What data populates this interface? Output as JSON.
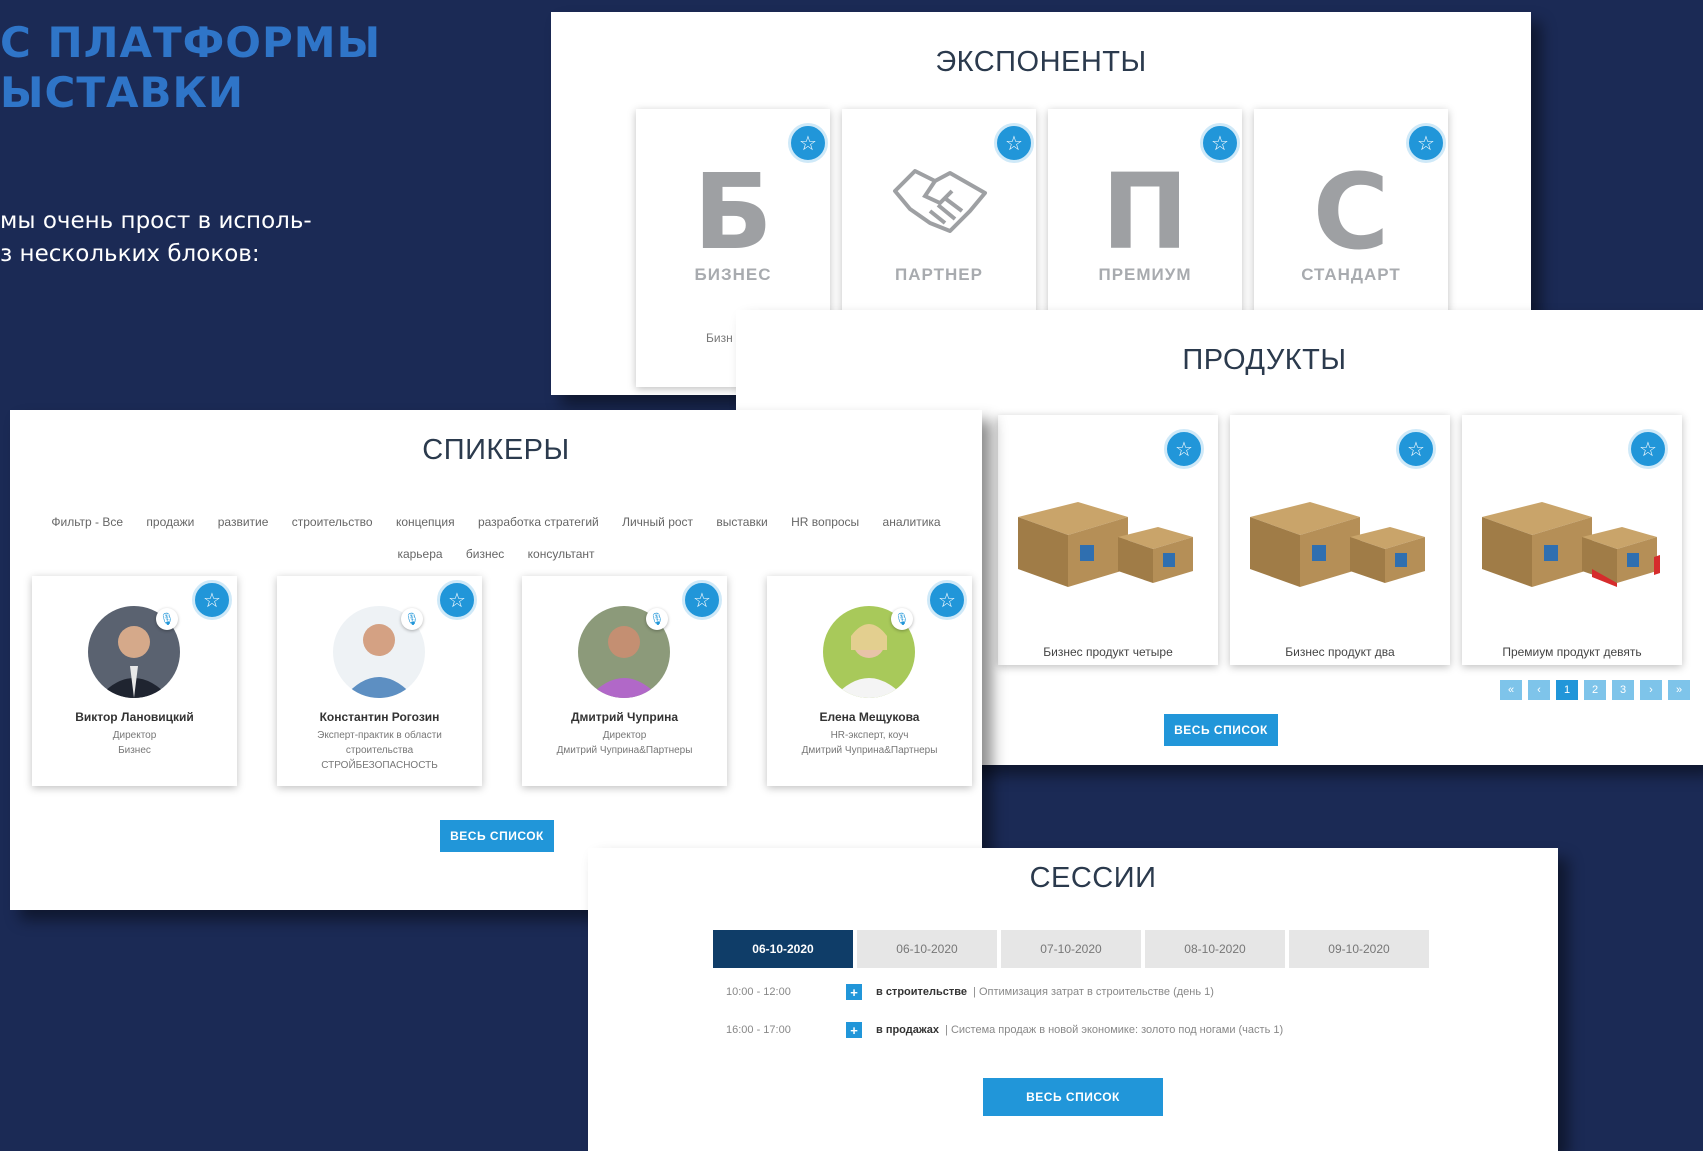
{
  "heading": {
    "line1": "С ПЛАТФОРМЫ",
    "line2": "ЫСТАВКИ"
  },
  "intro": {
    "line1": "мы очень прост в исполь-",
    "line2": "з нескольких блоков:"
  },
  "exhibitors": {
    "title": "ЭКСПОНЕНТЫ",
    "cards": [
      {
        "letter": "Б",
        "label": "БИЗНЕС",
        "sub": "Бизн"
      },
      {
        "letter": "",
        "label": "ПАРТНЕР",
        "sub": ""
      },
      {
        "letter": "П",
        "label": "ПРЕМИУМ",
        "sub": ""
      },
      {
        "letter": "С",
        "label": "СТАНДАРТ",
        "sub": ""
      }
    ]
  },
  "products": {
    "title": "ПРОДУКТЫ",
    "cards": [
      {
        "name": "Бизнес продукт четыре"
      },
      {
        "name": "Бизнес продукт два"
      },
      {
        "name": "Премиум продукт девять"
      }
    ],
    "pager": [
      "«",
      "‹",
      "1",
      "2",
      "3",
      "›",
      "»"
    ],
    "all_button": "ВЕСЬ СПИСОК"
  },
  "speakers": {
    "title": "СПИКЕРЫ",
    "filters": [
      "Фильтр - Все",
      "продажи",
      "развитие",
      "строительство",
      "концепция",
      "разработка стратегий",
      "Личный рост",
      "выставки",
      "HR вопросы",
      "аналитика",
      "карьера",
      "бизнес",
      "консультант"
    ],
    "cards": [
      {
        "name": "Виктор Лановицкий",
        "role1": "Директор",
        "role2": "Бизнес",
        "role3": ""
      },
      {
        "name": "Константин Рогозин",
        "role1": "Эксперт-практик в области",
        "role2": "строительства",
        "role3": "СТРОЙБЕЗОПАСНОСТЬ"
      },
      {
        "name": "Дмитрий Чуприна",
        "role1": "Директор",
        "role2": "Дмитрий Чуприна&Партнеры",
        "role3": ""
      },
      {
        "name": "Елена Мещукова",
        "role1": "HR-эксперт, коуч",
        "role2": "Дмитрий Чуприна&Партнеры",
        "role3": ""
      }
    ],
    "all_button": "ВЕСЬ СПИСОК"
  },
  "sessions": {
    "title": "СЕССИИ",
    "dates": [
      "06-10-2020",
      "06-10-2020",
      "07-10-2020",
      "08-10-2020",
      "09-10-2020"
    ],
    "rows": [
      {
        "time": "10:00 - 12:00",
        "track": "в строительстве",
        "desc": "| Оптимизация затрат в строительстве (день 1)"
      },
      {
        "time": "16:00 - 17:00",
        "track": "в продажах",
        "desc": "| Система продаж в новой экономике: золото под ногами (часть 1)"
      }
    ],
    "all_button": "ВЕСЬ СПИСОК"
  },
  "colors": {
    "background": "#1b2a55",
    "accent": "#2196d9",
    "active_tab": "#0f3d68"
  }
}
